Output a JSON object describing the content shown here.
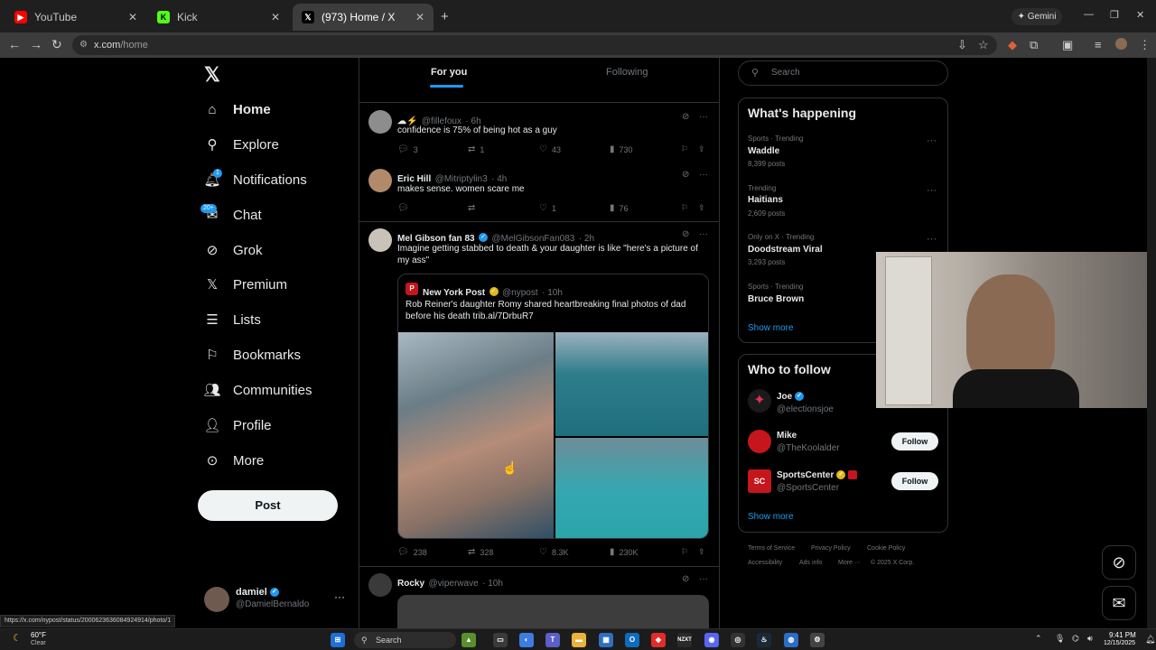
{
  "browser": {
    "tabs": [
      {
        "title": "YouTube",
        "active": false
      },
      {
        "title": "Kick",
        "active": false
      },
      {
        "title": "(973) Home / X",
        "active": true
      }
    ],
    "url_host": "x.com",
    "url_path": "/home",
    "gemini_label": "Gemini",
    "status_url": "https://x.com/nypost/status/2000623636084924914/photo/1"
  },
  "sidebar": {
    "items": [
      {
        "label": "Home",
        "icon": "home-icon"
      },
      {
        "label": "Explore",
        "icon": "search-icon"
      },
      {
        "label": "Notifications",
        "icon": "bell-icon"
      },
      {
        "label": "Chat",
        "icon": "mail-icon"
      },
      {
        "label": "Grok",
        "icon": "grok-icon"
      },
      {
        "label": "Premium",
        "icon": "x-logo-icon"
      },
      {
        "label": "Lists",
        "icon": "list-icon"
      },
      {
        "label": "Bookmarks",
        "icon": "bookmark-icon"
      },
      {
        "label": "Communities",
        "icon": "people-icon"
      },
      {
        "label": "Profile",
        "icon": "person-icon"
      },
      {
        "label": "More",
        "icon": "more-icon"
      }
    ],
    "notif_badge": "1",
    "chat_badge": "20+",
    "post_label": "Post",
    "account_name": "damiel",
    "account_handle": "@DamielBernaldo"
  },
  "feed": {
    "tab_for_you": "For you",
    "tab_following": "Following",
    "tweets": [
      {
        "name": "",
        "handle": "@fillefoux",
        "time": "· 6h",
        "text": "confidence is 75% of being hot as a guy",
        "replies": "3",
        "reposts": "1",
        "likes": "43",
        "views": "730"
      },
      {
        "name": "Eric Hill",
        "handle": "@Mitriptylin3",
        "time": "· 4h",
        "text": "makes sense. women scare me",
        "replies": "",
        "reposts": "",
        "likes": "1",
        "views": "76"
      },
      {
        "name": "Mel Gibson fan 83",
        "handle": "@MelGibsonFan083",
        "time": "· 2h",
        "text": "Imagine getting stabbed to death & your daughter is like \"here's a picture of my ass\"",
        "replies": "238",
        "reposts": "328",
        "likes": "8.3K",
        "views": "230K"
      },
      {
        "name": "Rocky",
        "handle": "@viperwave",
        "time": "· 10h",
        "text": ""
      }
    ],
    "quote": {
      "name": "New York Post",
      "handle": "@nypost",
      "time": "· 10h",
      "text": "Rob Reiner's daughter Romy shared heartbreaking final photos of dad before his death trib.al/7DrbuR7"
    }
  },
  "right": {
    "search_placeholder": "Search",
    "whats_happening": "What's happening",
    "trends": [
      {
        "context": "Sports · Trending",
        "name": "Waddle",
        "count": "8,399 posts"
      },
      {
        "context": "Trending",
        "name": "Haitians",
        "count": "2,609 posts"
      },
      {
        "context": "Only on X · Trending",
        "name": "Doodstream Viral",
        "count": "3,293 posts"
      },
      {
        "context": "Sports · Trending",
        "name": "Bruce Brown",
        "count": ""
      }
    ],
    "show_more": "Show more",
    "who_to_follow": "Who to follow",
    "follow_suggestions": [
      {
        "name": "Joe",
        "handle": "@electionsjoe"
      },
      {
        "name": "Mike",
        "handle": "@TheKoolalder"
      },
      {
        "name": "SportsCenter",
        "handle": "@SportsCenter"
      }
    ],
    "follow_label": "Follow",
    "footer": [
      "Terms of Service",
      "Privacy Policy",
      "Cookie Policy",
      "Accessibility",
      "Ads info",
      "More ···",
      "© 2025 X Corp."
    ]
  },
  "taskbar": {
    "weather_temp": "60°F",
    "weather_desc": "Clear",
    "search_label": "Search",
    "time": "9:41 PM",
    "date": "12/15/2025"
  },
  "colors": {
    "accent": "#1d9bf0",
    "background": "#000000",
    "border": "#2f3336",
    "muted": "#71767b"
  }
}
